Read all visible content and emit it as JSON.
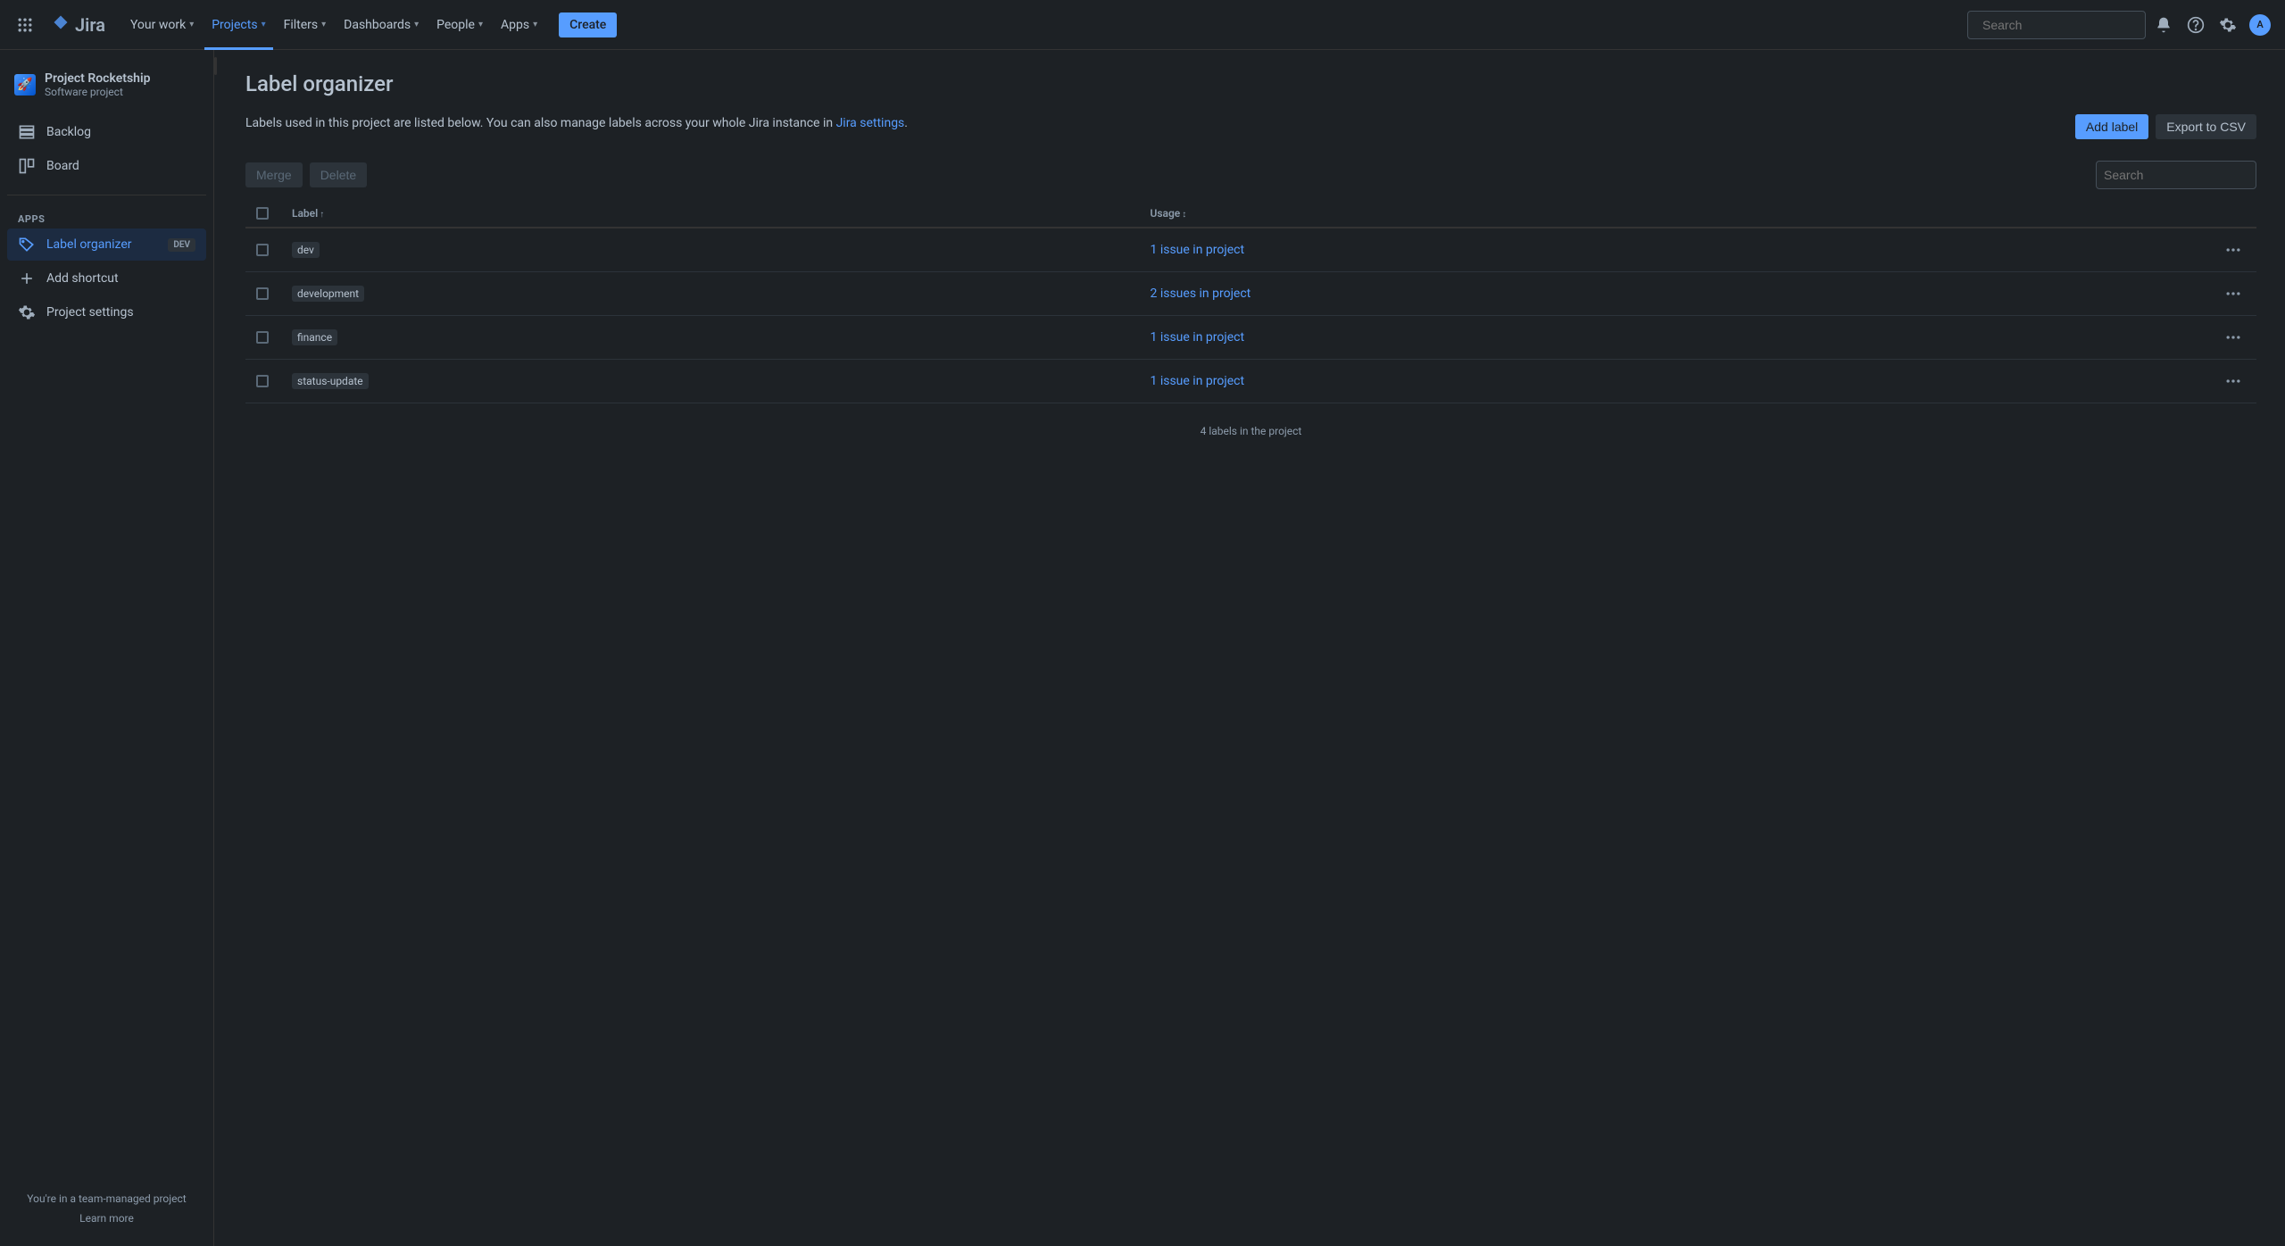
{
  "topnav": {
    "logo_text": "Jira",
    "items": [
      {
        "label": "Your work"
      },
      {
        "label": "Projects",
        "active": true
      },
      {
        "label": "Filters"
      },
      {
        "label": "Dashboards"
      },
      {
        "label": "People"
      },
      {
        "label": "Apps"
      }
    ],
    "create_label": "Create",
    "search_placeholder": "Search",
    "avatar_initial": "A"
  },
  "sidebar": {
    "project_name": "Project Rocketship",
    "project_type": "Software project",
    "nav": [
      {
        "label": "Backlog"
      },
      {
        "label": "Board"
      }
    ],
    "apps_section": "APPS",
    "apps": [
      {
        "label": "Label organizer",
        "badge": "DEV",
        "selected": true
      }
    ],
    "footer_nav": [
      {
        "label": "Add shortcut"
      },
      {
        "label": "Project settings"
      }
    ],
    "footer_text": "You're in a team-managed project",
    "learn_more": "Learn more"
  },
  "page": {
    "title": "Label organizer",
    "description_prefix": "Labels used in this project are listed below. You can also manage labels across your whole Jira instance in ",
    "description_link": "Jira settings",
    "description_suffix": ".",
    "add_label_btn": "Add label",
    "export_btn": "Export to CSV",
    "merge_btn": "Merge",
    "delete_btn": "Delete",
    "search_placeholder": "Search",
    "columns": {
      "label": "Label",
      "usage": "Usage"
    },
    "rows": [
      {
        "label": "dev",
        "usage": "1 issue in project"
      },
      {
        "label": "development",
        "usage": "2 issues in project"
      },
      {
        "label": "finance",
        "usage": "1 issue in project"
      },
      {
        "label": "status-update",
        "usage": "1 issue in project"
      }
    ],
    "footer": "4 labels in the project"
  }
}
